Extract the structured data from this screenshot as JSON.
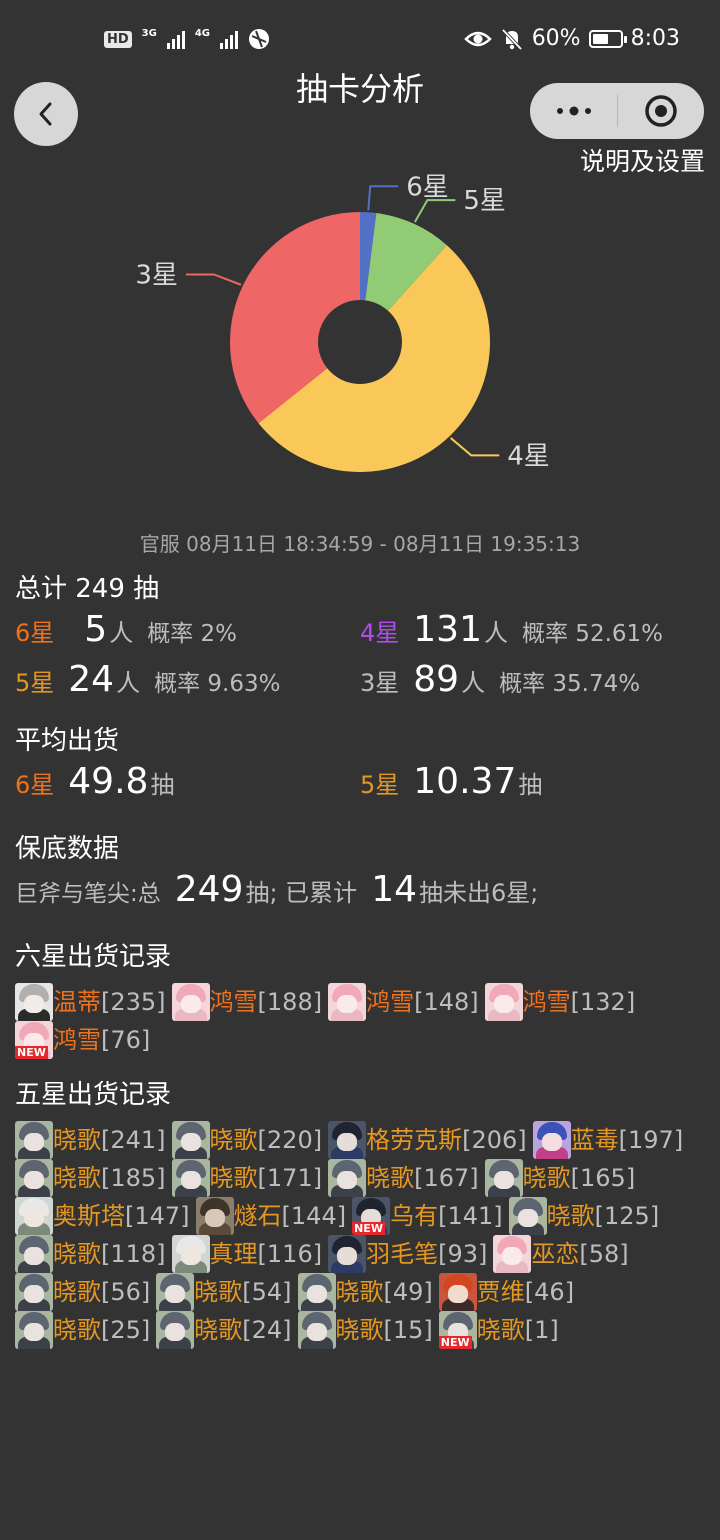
{
  "status_bar": {
    "hd": "HD",
    "sim": "2",
    "net1": "3G",
    "net2": "4G",
    "battery": "60%",
    "battery_level": 0.6,
    "time": "8:03"
  },
  "nav": {
    "title": "抽卡分析",
    "back_icon": "chevron-left-icon",
    "more_icon": "more-dots-icon",
    "target_icon": "target-icon",
    "settings_link": "说明及设置"
  },
  "chart_data": {
    "type": "pie",
    "donut": true,
    "categories": [
      "6星",
      "5星",
      "4星",
      "3星"
    ],
    "values": [
      5,
      24,
      131,
      89
    ],
    "colors": [
      "#5470c6",
      "#91cc75",
      "#fac858",
      "#ee6666"
    ]
  },
  "summary": {
    "time_range": "官服 08月11日 18:34:59 - 08月11日 19:35:13",
    "total_title": "总计 249 抽",
    "stats": [
      {
        "star": "6星",
        "count": "5",
        "unit": "人",
        "rate": "概率 2%"
      },
      {
        "star": "4星",
        "count": "131",
        "unit": "人",
        "rate": "概率 52.61%"
      },
      {
        "star": "5星",
        "count": "24",
        "unit": "人",
        "rate": "概率 9.63%"
      },
      {
        "star": "3星",
        "count": "89",
        "unit": "人",
        "rate": "概率 35.74%"
      }
    ]
  },
  "average": {
    "title": "平均出货",
    "six_star": "6星",
    "six_value": "49.8",
    "five_star": "5星",
    "five_value": "10.37",
    "unit": "抽"
  },
  "pity": {
    "title": "保底数据",
    "pool_prefix": "巨斧与笔尖:总",
    "total": "249",
    "mid": "抽; 已累计",
    "since": "14",
    "suffix": "抽未出6星;"
  },
  "six_star_records": {
    "title": "六星出货记录",
    "items": [
      {
        "name": "温蒂",
        "count": "[235]",
        "new": false,
        "avatar": "wendy"
      },
      {
        "name": "鸿雪",
        "count": "[188]",
        "new": false,
        "avatar": "pink"
      },
      {
        "name": "鸿雪",
        "count": "[148]",
        "new": false,
        "avatar": "pink"
      },
      {
        "name": "鸿雪",
        "count": "[132]",
        "new": false,
        "avatar": "pink"
      },
      {
        "name": "鸿雪",
        "count": "[76]",
        "new": true,
        "new_label": "NEW",
        "avatar": "pink"
      }
    ]
  },
  "five_star_records": {
    "title": "五星出货记录",
    "items": [
      {
        "name": "晓歌",
        "count": "[241]",
        "new": false,
        "avatar": "grey"
      },
      {
        "name": "晓歌",
        "count": "[220]",
        "new": false,
        "avatar": "grey"
      },
      {
        "name": "格劳克斯",
        "count": "[206]",
        "new": false,
        "avatar": "dark"
      },
      {
        "name": "蓝毒",
        "count": "[197]",
        "new": false,
        "avatar": "blue"
      },
      {
        "name": "晓歌",
        "count": "[185]",
        "new": false,
        "avatar": "grey"
      },
      {
        "name": "晓歌",
        "count": "[171]",
        "new": false,
        "avatar": "grey"
      },
      {
        "name": "晓歌",
        "count": "[167]",
        "new": false,
        "avatar": "grey"
      },
      {
        "name": "晓歌",
        "count": "[165]",
        "new": false,
        "avatar": "grey"
      },
      {
        "name": "奥斯塔",
        "count": "[147]",
        "new": false,
        "avatar": "white"
      },
      {
        "name": "燧石",
        "count": "[144]",
        "new": false,
        "avatar": "brown"
      },
      {
        "name": "乌有",
        "count": "[141]",
        "new": true,
        "new_label": "NEW",
        "avatar": "dark"
      },
      {
        "name": "晓歌",
        "count": "[125]",
        "new": false,
        "avatar": "grey"
      },
      {
        "name": "晓歌",
        "count": "[118]",
        "new": false,
        "avatar": "grey"
      },
      {
        "name": "真理",
        "count": "[116]",
        "new": false,
        "avatar": "white"
      },
      {
        "name": "羽毛笔",
        "count": "[93]",
        "new": false,
        "avatar": "dark"
      },
      {
        "name": "巫恋",
        "count": "[58]",
        "new": false,
        "avatar": "pink"
      },
      {
        "name": "晓歌",
        "count": "[56]",
        "new": false,
        "avatar": "grey"
      },
      {
        "name": "晓歌",
        "count": "[54]",
        "new": false,
        "avatar": "grey"
      },
      {
        "name": "晓歌",
        "count": "[49]",
        "new": false,
        "avatar": "grey"
      },
      {
        "name": "贾维",
        "count": "[46]",
        "new": false,
        "avatar": "red"
      },
      {
        "name": "晓歌",
        "count": "[25]",
        "new": false,
        "avatar": "grey"
      },
      {
        "name": "晓歌",
        "count": "[24]",
        "new": false,
        "avatar": "grey"
      },
      {
        "name": "晓歌",
        "count": "[15]",
        "new": false,
        "avatar": "grey"
      },
      {
        "name": "晓歌",
        "count": "[1]",
        "new": true,
        "new_label": "NEW",
        "avatar": "grey"
      }
    ]
  }
}
